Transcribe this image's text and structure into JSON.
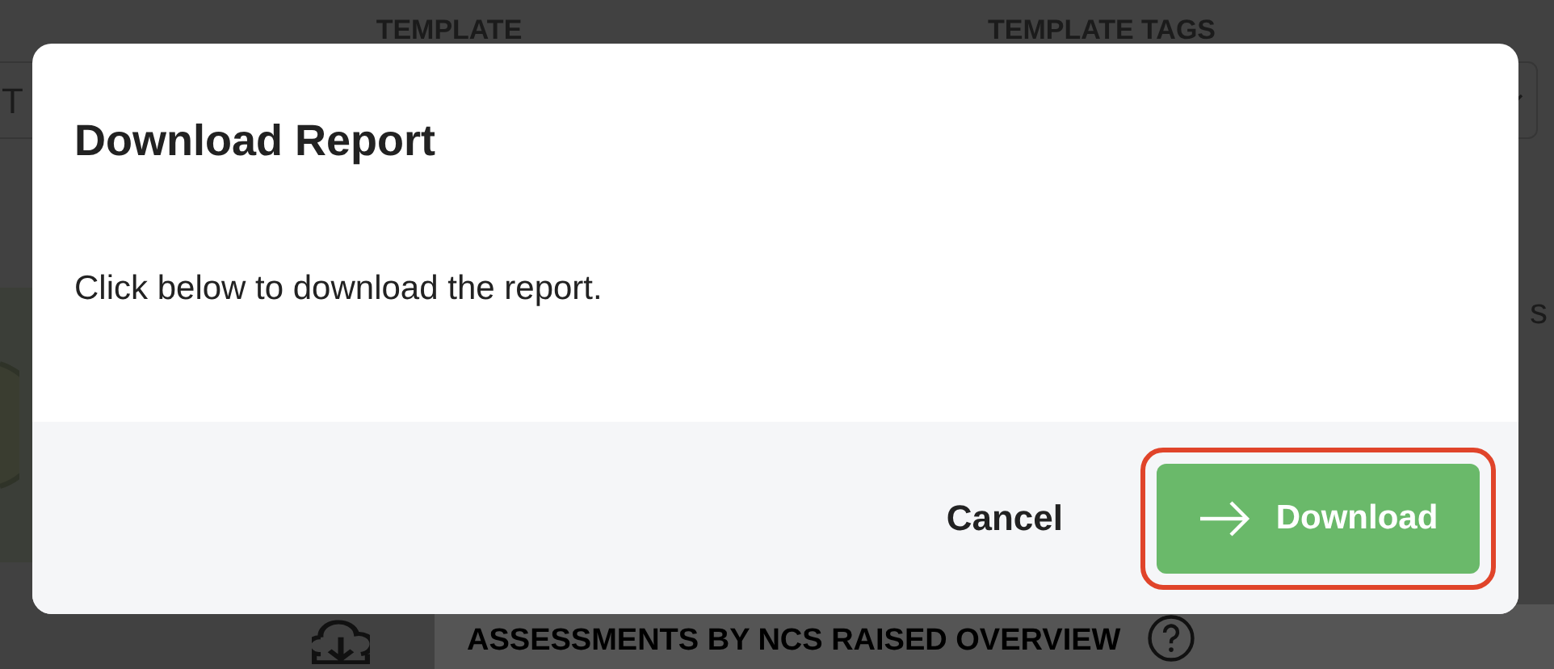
{
  "background": {
    "column_headers": [
      "TEMPLATE",
      "TEMPLATE TAGS"
    ],
    "filter_value": "T",
    "side_text": "s",
    "panel_title": "ASSESSMENTS BY NCS RAISED OVERVIEW"
  },
  "modal": {
    "title": "Download Report",
    "body": "Click below to download the report.",
    "buttons": [
      {
        "label": "Cancel",
        "kind": "secondary",
        "focused": false
      },
      {
        "label": "Download",
        "kind": "primary",
        "focused": true
      }
    ]
  }
}
